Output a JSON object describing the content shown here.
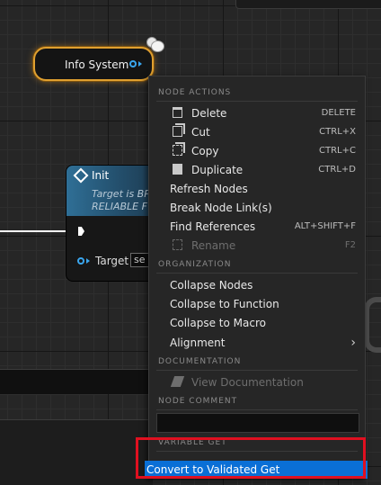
{
  "graph": {
    "var_node": {
      "label": "Info System"
    },
    "func_node": {
      "title": "Init",
      "subtitle_1": "Target is BP",
      "subtitle_2": "RELIABLE F",
      "target_label": "Target",
      "target_value": "se"
    }
  },
  "context_menu": {
    "sections": {
      "node_actions": "NODE ACTIONS",
      "organization": "ORGANIZATION",
      "documentation": "DOCUMENTATION",
      "node_comment": "NODE COMMENT",
      "variable_get": "VARIABLE GET"
    },
    "items": [
      {
        "label": "Delete",
        "shortcut": "DELETE",
        "icon": "trash-icon"
      },
      {
        "label": "Cut",
        "shortcut": "CTRL+X",
        "icon": "cut-icon"
      },
      {
        "label": "Copy",
        "shortcut": "CTRL+C",
        "icon": "copy-icon"
      },
      {
        "label": "Duplicate",
        "shortcut": "CTRL+D",
        "icon": "duplicate-icon"
      },
      {
        "label": "Refresh Nodes"
      },
      {
        "label": "Break Node Link(s)"
      },
      {
        "label": "Find References",
        "shortcut": "ALT+SHIFT+F"
      },
      {
        "label": "Rename",
        "shortcut": "F2",
        "icon": "rename-icon",
        "disabled": true
      }
    ],
    "organization_items": [
      {
        "label": "Collapse Nodes"
      },
      {
        "label": "Collapse to Function"
      },
      {
        "label": "Collapse to Macro"
      },
      {
        "label": "Alignment",
        "submenu": true
      }
    ],
    "documentation_item": {
      "label": "View Documentation",
      "disabled": true,
      "icon": "book-icon"
    },
    "node_comment_value": "",
    "variable_get_item": {
      "label": "Convert to Validated Get",
      "highlighted": true
    }
  },
  "colors": {
    "highlight": "#0a6fd6",
    "annotation_box": "#e01020",
    "var_node_border": "#e0a030",
    "func_header": "#2f6f96",
    "pin": "#3aa6ee"
  }
}
